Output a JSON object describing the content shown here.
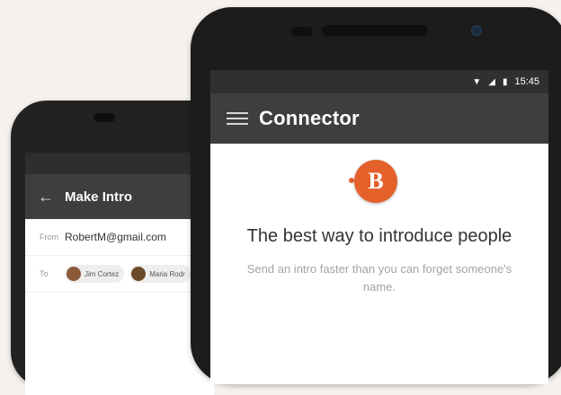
{
  "front_phone": {
    "status": {
      "time": "15:45",
      "wifi_icon": "wifi-icon",
      "signal_icon": "signal-icon",
      "battery_icon": "battery-icon"
    },
    "toolbar": {
      "title": "Connector",
      "menu_icon": "hamburger-menu-icon"
    },
    "content": {
      "logo_letter": "B",
      "headline": "The best way to introduce people",
      "subline": "Send an intro faster than you can forget someone's name."
    }
  },
  "back_phone": {
    "toolbar": {
      "title": "Make Intro",
      "back_icon": "back-arrow-icon"
    },
    "form": {
      "from_label": "From",
      "from_value": "RobertM@gmail.com",
      "to_label": "To",
      "recipients": [
        {
          "name": "Jim Cortez",
          "avatar_color": "#8a5a3b"
        },
        {
          "name": "Maria Rodr",
          "avatar_color": "#6b4a2b"
        }
      ]
    }
  },
  "colors": {
    "accent": "#e4612c",
    "toolbar": "#3e3e3e",
    "background": "#f6f1ed"
  }
}
